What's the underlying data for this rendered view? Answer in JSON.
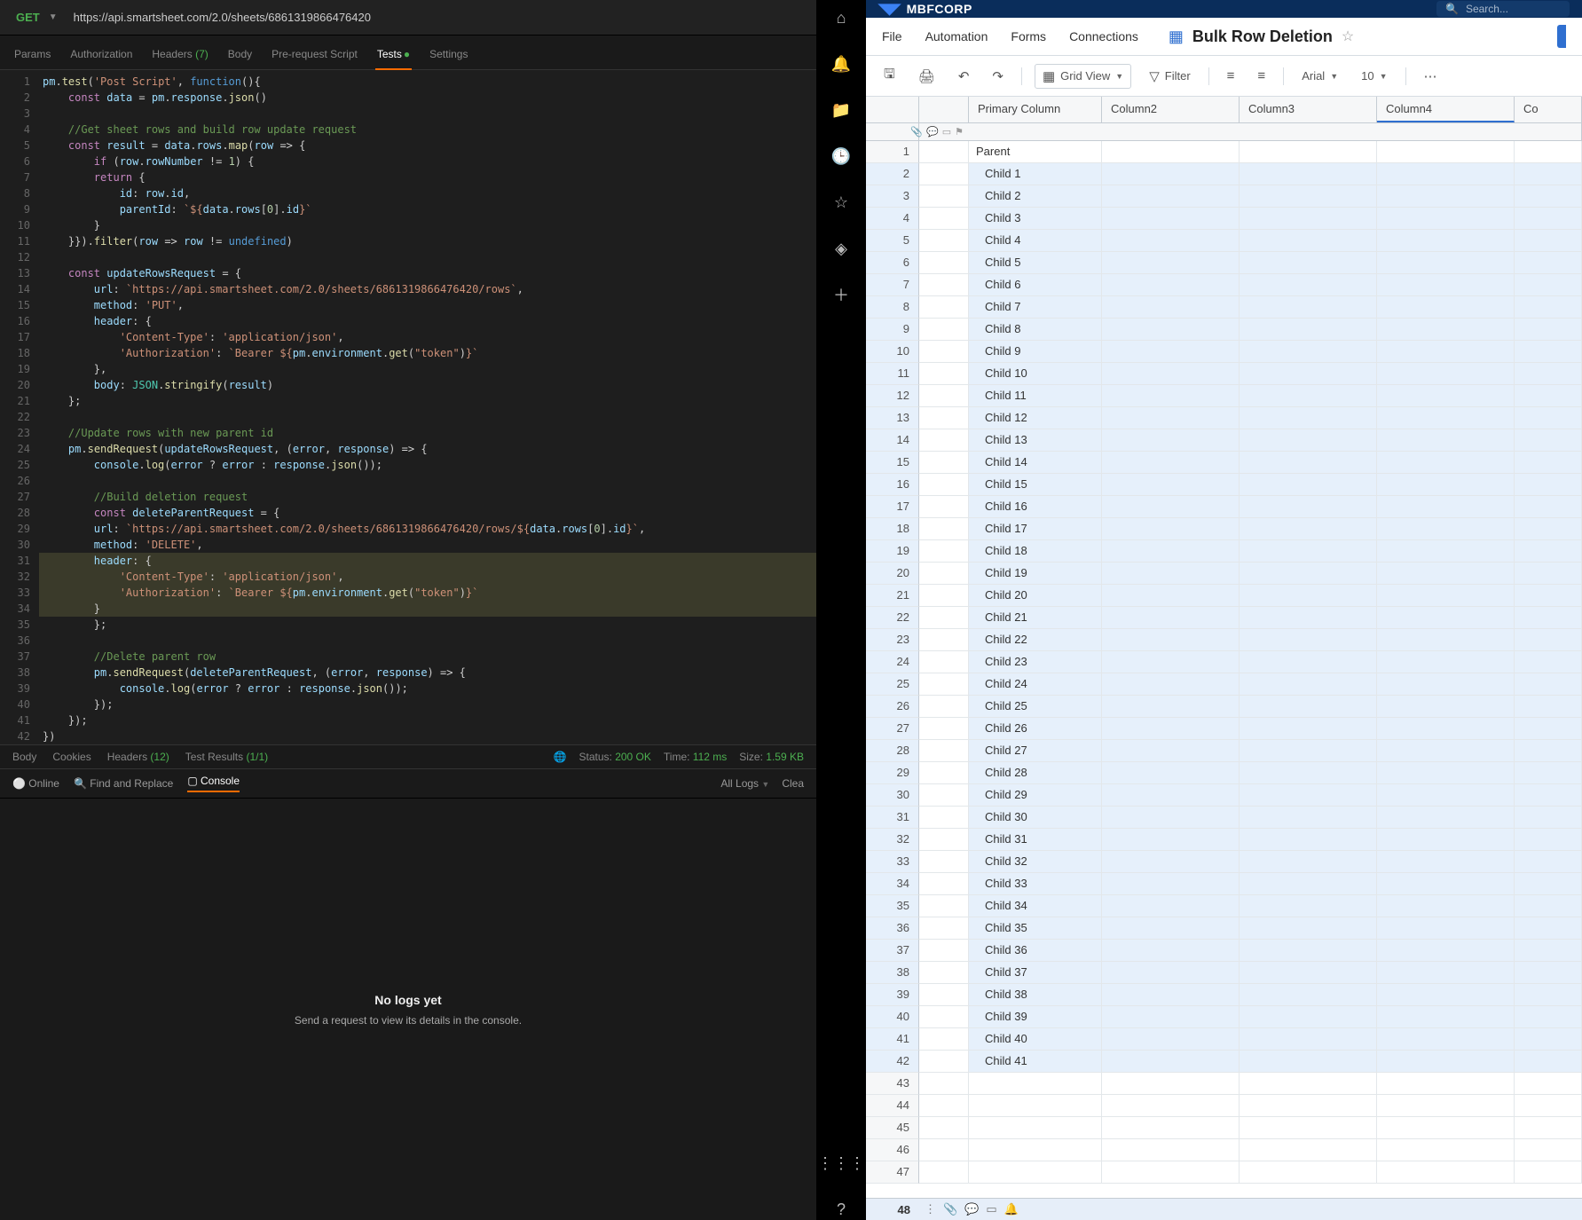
{
  "postman": {
    "method": "GET",
    "url": "https://api.smartsheet.com/2.0/sheets/6861319866476420",
    "tabs": {
      "params": "Params",
      "auth": "Authorization",
      "headers": "Headers",
      "headers_count": "(7)",
      "body": "Body",
      "prereq": "Pre-request Script",
      "tests": "Tests",
      "settings": "Settings"
    },
    "response": {
      "tabs": {
        "body": "Body",
        "cookies": "Cookies",
        "headers": "Headers",
        "headers_count": "(12)",
        "results": "Test Results",
        "results_count": "(1/1)"
      },
      "status_label": "Status:",
      "status_value": "200 OK",
      "time_label": "Time:",
      "time_value": "112 ms",
      "size_label": "Size:",
      "size_value": "1.59 KB"
    },
    "footer": {
      "online": "Online",
      "find": "Find and Replace",
      "console": "Console",
      "alllogs": "All Logs",
      "clear": "Clea"
    },
    "console": {
      "title": "No logs yet",
      "subtitle": "Send a request to view its details in the console."
    }
  },
  "smartsheet": {
    "brand": "MBFCORP",
    "search_placeholder": "Search...",
    "menu": {
      "file": "File",
      "automation": "Automation",
      "forms": "Forms",
      "connections": "Connections"
    },
    "sheet_title": "Bulk Row Deletion",
    "toolbar": {
      "grid_view": "Grid View",
      "filter": "Filter",
      "font": "Arial",
      "font_size": "10"
    },
    "columns": [
      "Primary Column",
      "Column2",
      "Column3",
      "Column4",
      "Co"
    ],
    "parent_label": "Parent",
    "child_count": 41,
    "total_rows_visible": 47,
    "footer_num": "48"
  }
}
